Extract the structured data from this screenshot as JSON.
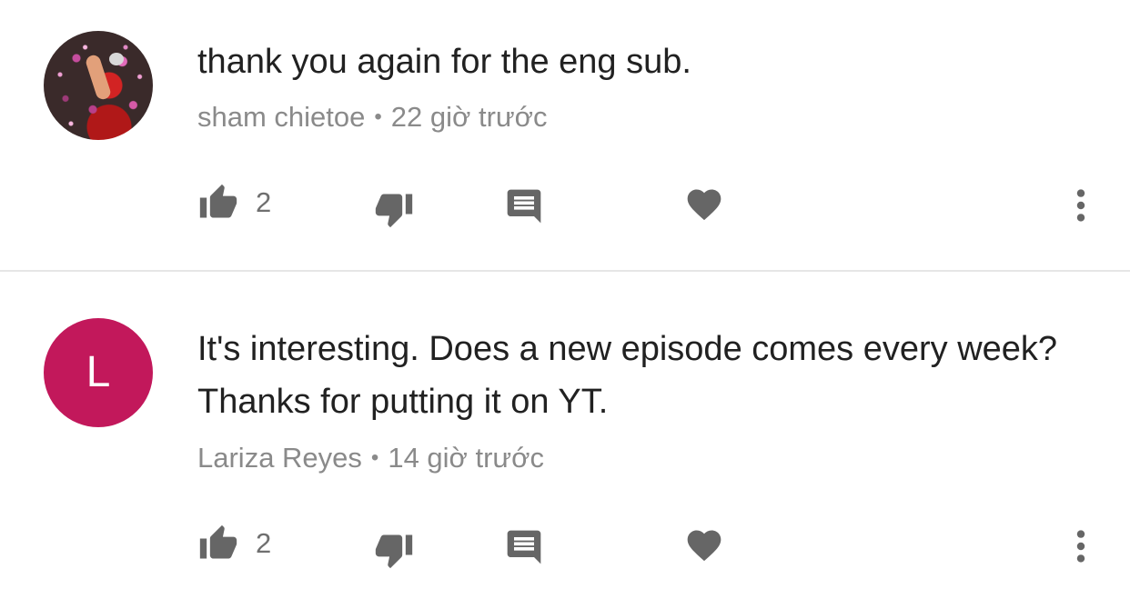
{
  "comments": [
    {
      "text": "thank you again for the eng sub.",
      "author": "sham chietoe",
      "separator": "•",
      "time": "22 giờ trước",
      "likes": "2",
      "avatar_type": "photo"
    },
    {
      "text": "It's interesting. Does a new episode comes every week? Thanks for putting it on YT.",
      "author": "Lariza Reyes",
      "separator": "•",
      "time": "14 giờ trước",
      "likes": "2",
      "avatar_type": "letter",
      "avatar_letter": "L",
      "avatar_color": "#c2185b"
    }
  ],
  "icon_color": "#666666"
}
